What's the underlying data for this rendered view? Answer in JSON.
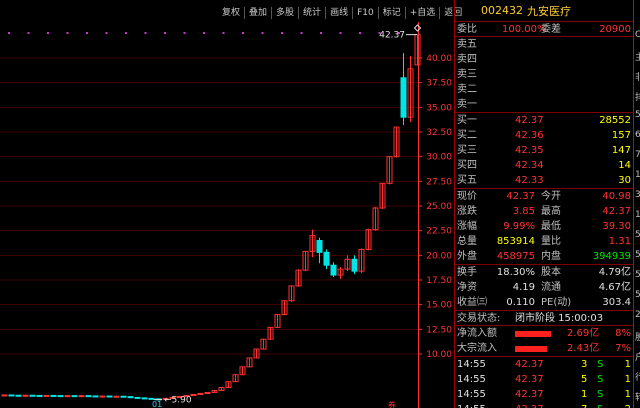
{
  "toolbar": [
    "复权",
    "叠加",
    "多股",
    "统计",
    "画线",
    "F10",
    "标记",
    "+自选",
    "返回"
  ],
  "chart": {
    "y_ticks": [
      "40.00",
      "37.50",
      "35.00",
      "32.50",
      "30.00",
      "27.50",
      "25.00",
      "22.50",
      "20.00",
      "17.50",
      "15.00",
      "12.50",
      "10.00"
    ],
    "high_label": "42.37",
    "low_label": "5.90",
    "bottom_marker": "01",
    "event_marker": "券",
    "colors": {
      "up": "#ff3232",
      "down": "#00e6e6",
      "axis": "#ff3232",
      "grid": "#800000"
    }
  },
  "panel": {
    "code": "002432",
    "name": "九安医疗",
    "weibi": {
      "label": "委比",
      "value": "100.00%",
      "label2": "委差",
      "value2": "20900"
    },
    "asks": [
      {
        "label": "卖五"
      },
      {
        "label": "卖四"
      },
      {
        "label": "卖三"
      },
      {
        "label": "卖二"
      },
      {
        "label": "卖一"
      }
    ],
    "bids": [
      {
        "label": "买一",
        "price": "42.37",
        "vol": "28552"
      },
      {
        "label": "买二",
        "price": "42.36",
        "vol": "157"
      },
      {
        "label": "买三",
        "price": "42.35",
        "vol": "147"
      },
      {
        "label": "买四",
        "price": "42.34",
        "vol": "14"
      },
      {
        "label": "买五",
        "price": "42.33",
        "vol": "30"
      }
    ],
    "quote": [
      {
        "l1": "现价",
        "v1": "42.37",
        "c1": "red",
        "l2": "今开",
        "v2": "40.98",
        "c2": "red"
      },
      {
        "l1": "涨跌",
        "v1": "3.85",
        "c1": "red",
        "l2": "最高",
        "v2": "42.37",
        "c2": "red"
      },
      {
        "l1": "涨幅",
        "v1": "9.99%",
        "c1": "red",
        "l2": "最低",
        "v2": "39.30",
        "c2": "red"
      },
      {
        "l1": "总量",
        "v1": "853914",
        "c1": "yellow",
        "l2": "量比",
        "v2": "1.31",
        "c2": "red"
      },
      {
        "l1": "外盘",
        "v1": "458975",
        "c1": "red",
        "l2": "内盘",
        "v2": "394939",
        "c2": "green"
      }
    ],
    "stats": [
      {
        "l1": "换手",
        "v1": "18.30%",
        "l2": "股本",
        "v2": "4.79亿"
      },
      {
        "l1": "净资",
        "v1": "4.19",
        "l2": "流通",
        "v2": "4.67亿"
      },
      {
        "l1": "收益㈢",
        "v1": "0.110",
        "l2": "PE(动)",
        "v2": "303.4"
      }
    ],
    "status": {
      "label": "交易状态:",
      "value": "闭市阶段 15:00:03"
    },
    "flows": [
      {
        "label": "净流入额",
        "value": "2.69亿",
        "pct": "8%",
        "fill": 0.8
      },
      {
        "label": "大宗流入",
        "value": "2.43亿",
        "pct": "7%",
        "fill": 0.72
      }
    ],
    "ticks": [
      {
        "time": "14:55",
        "price": "42.37",
        "vol": "3",
        "side": "S",
        "count": "1"
      },
      {
        "time": "14:55",
        "price": "42.37",
        "vol": "5",
        "side": "S",
        "count": "1"
      },
      {
        "time": "14:55",
        "price": "42.37",
        "vol": "1",
        "side": "S",
        "count": "1"
      },
      {
        "time": "14:55",
        "price": "42.37",
        "vol": "7",
        "side": "S",
        "count": "2"
      }
    ]
  },
  "far_right": [
    "C",
    "主",
    "非",
    "排",
    "5",
    "6",
    "7",
    "1",
    "3",
    "1",
    "5",
    "5",
    "5",
    "5",
    "2",
    "股",
    "户",
    "行",
    "转"
  ]
}
